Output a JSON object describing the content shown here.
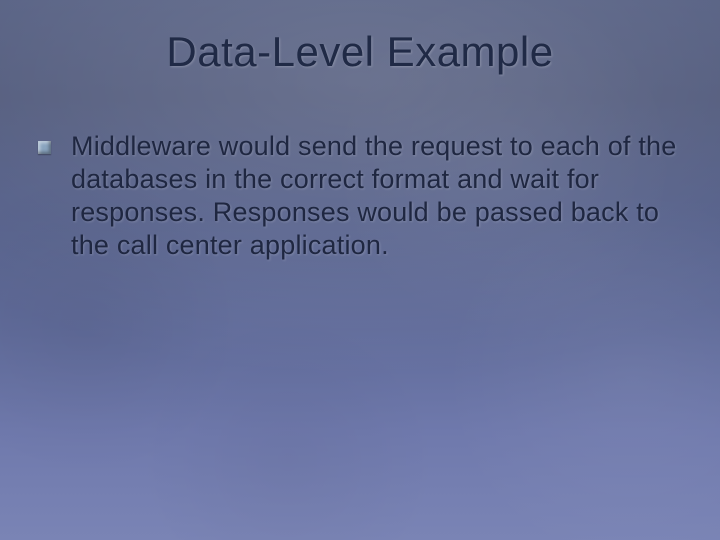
{
  "slide": {
    "title": "Data-Level Example",
    "bullets": [
      {
        "text": "Middleware would send the request to each of the databases in the correct format and wait for responses.  Responses would be passed back to the call center application."
      }
    ]
  }
}
